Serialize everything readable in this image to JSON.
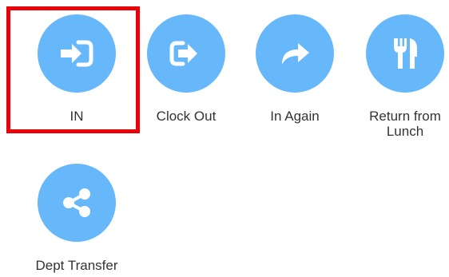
{
  "actions": [
    {
      "label": "IN",
      "icon": "sign-in-icon",
      "selected": true
    },
    {
      "label": "Clock Out",
      "icon": "sign-out-icon",
      "selected": false
    },
    {
      "label": "In Again",
      "icon": "share-arrow-icon",
      "selected": false
    },
    {
      "label": "Return from\nLunch",
      "icon": "utensils-icon",
      "selected": false
    },
    {
      "label": "Dept Transfer",
      "icon": "share-nodes-icon",
      "selected": false
    }
  ],
  "colors": {
    "button": "#66b8fb",
    "selection": "#e8000b",
    "label": "#333333"
  }
}
